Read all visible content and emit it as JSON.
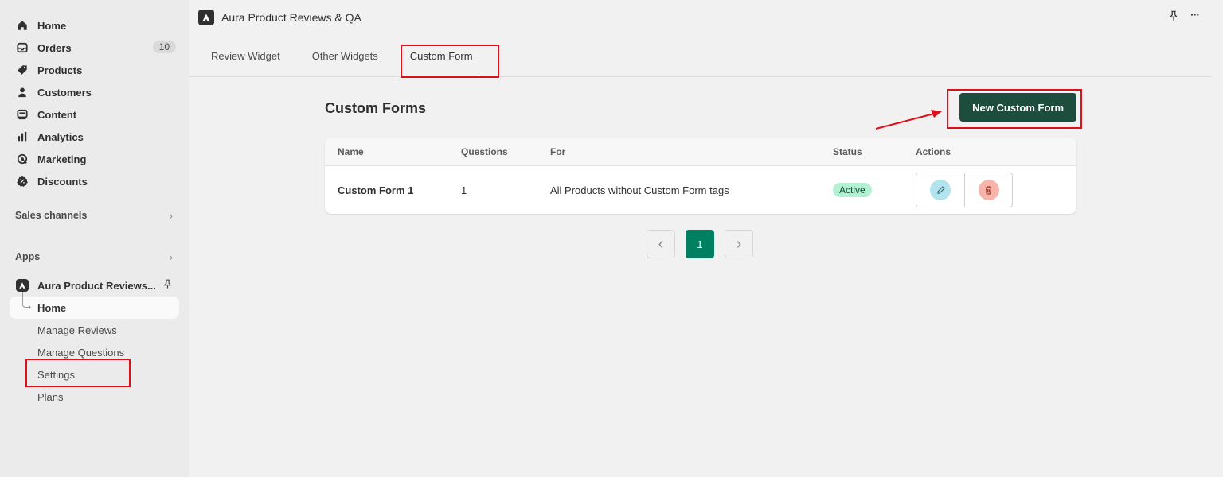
{
  "sidebar": {
    "items": [
      {
        "label": "Home",
        "icon": "home-icon"
      },
      {
        "label": "Orders",
        "icon": "inbox-icon",
        "badge": "10"
      },
      {
        "label": "Products",
        "icon": "tag-icon"
      },
      {
        "label": "Customers",
        "icon": "person-icon"
      },
      {
        "label": "Content",
        "icon": "content-icon"
      },
      {
        "label": "Analytics",
        "icon": "bar-chart-icon"
      },
      {
        "label": "Marketing",
        "icon": "target-icon"
      },
      {
        "label": "Discounts",
        "icon": "discount-icon"
      }
    ],
    "sales_channels": "Sales channels",
    "apps": "Apps",
    "app_name": "Aura Product Reviews...",
    "app_sub": [
      {
        "label": "Home"
      },
      {
        "label": "Manage Reviews"
      },
      {
        "label": "Manage Questions"
      },
      {
        "label": "Settings"
      },
      {
        "label": "Plans"
      }
    ]
  },
  "topbar": {
    "title": "Aura Product Reviews & QA",
    "more": "···"
  },
  "tabs": [
    {
      "label": "Review Widget"
    },
    {
      "label": "Other Widgets"
    },
    {
      "label": "Custom Form"
    }
  ],
  "main": {
    "page_title": "Custom Forms",
    "new_button": "New Custom Form",
    "table": {
      "headers": [
        "Name",
        "Questions",
        "For",
        "Status",
        "Actions"
      ],
      "rows": [
        {
          "name": "Custom Form 1",
          "questions": "1",
          "for": "All Products without Custom Form tags",
          "status": "Active"
        }
      ]
    },
    "pagination": {
      "current": "1",
      "prev": "‹",
      "next": "›"
    }
  },
  "colors": {
    "primary": "#1c4d3d",
    "page_active": "#008060",
    "status_bg": "#b4f0d2",
    "highlight": "#e0101a"
  }
}
